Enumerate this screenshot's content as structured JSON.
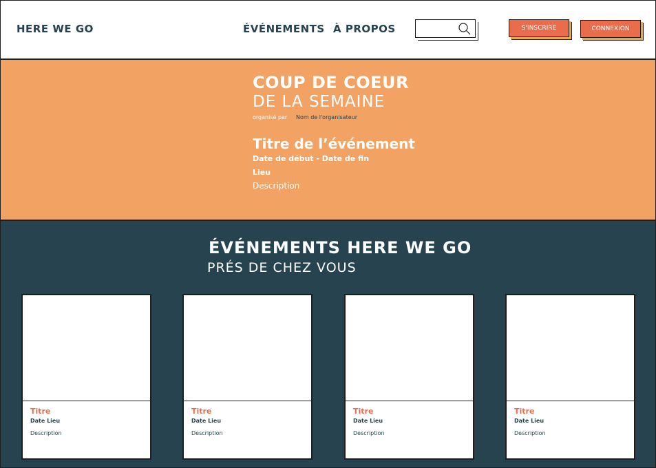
{
  "header": {
    "logo": "HERE WE GO",
    "nav": {
      "events": "ÉVÉNEMENTS",
      "about": "À PROPOS"
    },
    "search": {
      "placeholder": "",
      "icon": "search-icon"
    },
    "signup_label": "S'INSCRIRE",
    "login_label": "CONNEXION"
  },
  "featured": {
    "title_line1": "COUP DE COEUR",
    "title_line2": "DE LA SEMAINE",
    "organizer_label": "organisé par",
    "organizer_name": "Nom de l'organisateur",
    "event_title": "Titre de l’événement",
    "dates": "Date de début - Date de fin",
    "place": "Lieu",
    "description": "Description"
  },
  "events": {
    "title_line1": "ÉVÉNEMENTS HERE WE GO",
    "title_line2": "PRÉS DE CHEZ VOUS",
    "cards": [
      {
        "title": "Titre",
        "meta": "Date Lieu",
        "description": "Description"
      },
      {
        "title": "Titre",
        "meta": "Date Lieu",
        "description": "Description"
      },
      {
        "title": "Titre",
        "meta": "Date Lieu",
        "description": "Description"
      },
      {
        "title": "Titre",
        "meta": "Date Lieu",
        "description": "Description"
      }
    ]
  },
  "colors": {
    "accent": "#e96d4d",
    "featured_bg": "#f2a262",
    "dark": "#27434f"
  }
}
